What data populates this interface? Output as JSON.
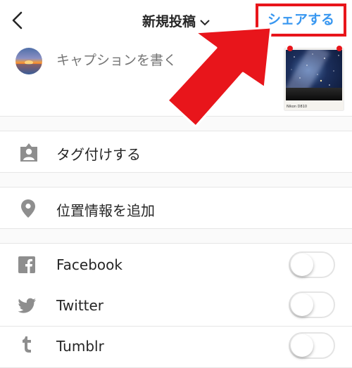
{
  "header": {
    "title": "新規投稿",
    "share_label": "シェアする"
  },
  "composer": {
    "caption_placeholder": "キャプションを書く",
    "thumbnail_caption": "Nikon D810"
  },
  "options": {
    "tag_people": "タグ付けする",
    "add_location": "位置情報を追加"
  },
  "share_to": [
    {
      "label": "Facebook",
      "enabled": false
    },
    {
      "label": "Twitter",
      "enabled": false
    },
    {
      "label": "Tumblr",
      "enabled": false
    }
  ],
  "colors": {
    "accent": "#3897f0",
    "highlight": "#e8151b",
    "icon": "#8e8e8e"
  }
}
